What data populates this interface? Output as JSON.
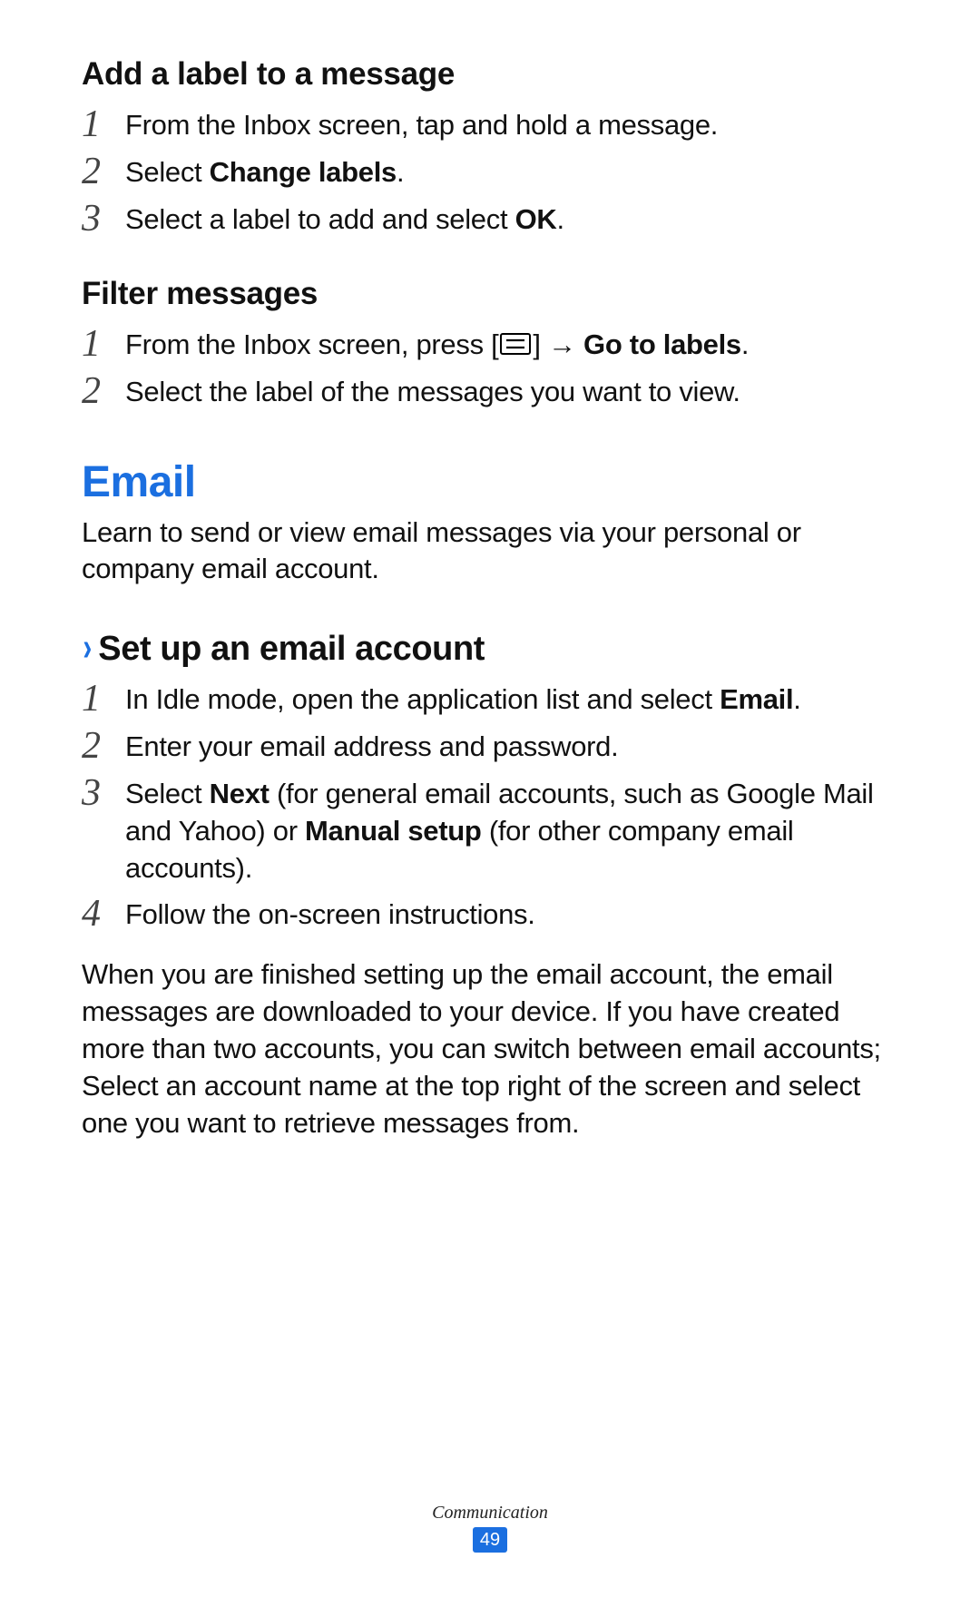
{
  "sections": {
    "add_label": {
      "title": "Add a label to a message",
      "steps": {
        "s1_num": "1",
        "s1_txt": "From the Inbox screen, tap and hold a message.",
        "s2_num": "2",
        "s2_pre": "Select ",
        "s2_bold": "Change labels",
        "s2_post": ".",
        "s3_num": "3",
        "s3_pre": "Select a label to add and select ",
        "s3_bold": "OK",
        "s3_post": "."
      }
    },
    "filter": {
      "title": "Filter messages",
      "steps": {
        "s1_num": "1",
        "s1_pre": "From the Inbox screen, press [",
        "s1_mid": "] → ",
        "s1_bold": "Go to labels",
        "s1_post": ".",
        "s2_num": "2",
        "s2_txt": "Select the label of the messages you want to view."
      }
    },
    "email": {
      "title": "Email",
      "intro": "Learn to send or view email messages via your personal or company email account."
    },
    "setup": {
      "chevron": "›",
      "title": "Set up an email account",
      "steps": {
        "s1_num": "1",
        "s1_pre": "In Idle mode, open the application list and select ",
        "s1_bold": "Email",
        "s1_post": ".",
        "s2_num": "2",
        "s2_txt": "Enter your email address and password.",
        "s3_num": "3",
        "s3_pre": "Select ",
        "s3_bold1": "Next",
        "s3_mid": " (for general email accounts, such as Google Mail and Yahoo) or ",
        "s3_bold2": "Manual setup",
        "s3_post": " (for other company email accounts).",
        "s4_num": "4",
        "s4_txt": "Follow the on-screen instructions."
      },
      "outro": "When you are finished setting up the email account, the email messages are downloaded to your device. If you have created more than two accounts, you can switch between email accounts; Select an account name at the top right of the screen and select one you want to retrieve messages from."
    }
  },
  "footer": {
    "section_name": "Communication",
    "page_number": "49"
  }
}
